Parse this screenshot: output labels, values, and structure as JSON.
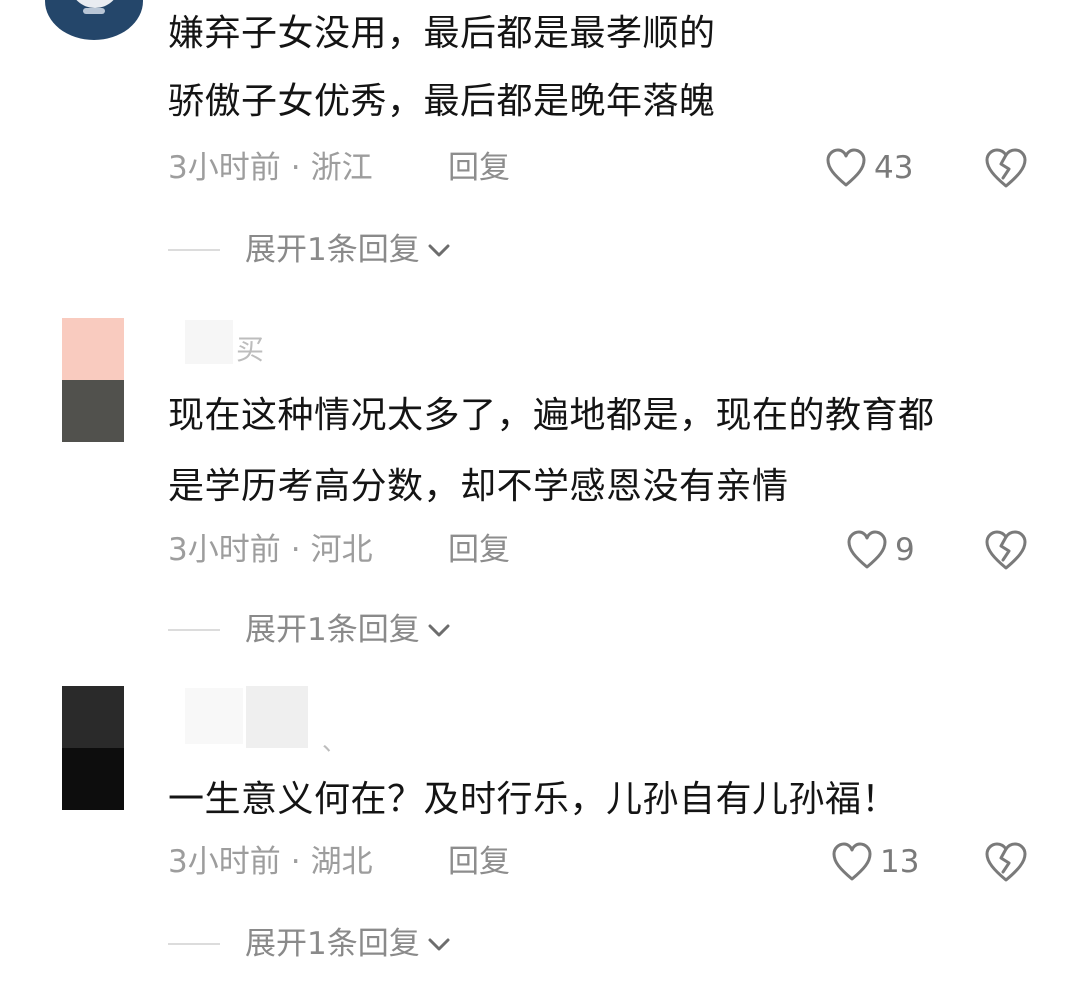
{
  "comments": [
    {
      "lines": [
        "嫌弃子女没用，最后都是最孝顺的",
        "骄傲子女优秀，最后都是晚年落魄"
      ],
      "time": "3小时前",
      "location": "浙江",
      "reply_label": "回复",
      "likes": "43",
      "expand_label": "展开1条回复"
    },
    {
      "username": "买",
      "lines": [
        "现在这种情况太多了，遍地都是，现在的教育都",
        "是学历考高分数，却不学感恩没有亲情"
      ],
      "time": "3小时前",
      "location": "河北",
      "reply_label": "回复",
      "likes": "9",
      "expand_label": "展开1条回复"
    },
    {
      "username": "、",
      "lines": [
        "一生意义何在？及时行乐，儿孙自有儿孙福！"
      ],
      "time": "3小时前",
      "location": "湖北",
      "reply_label": "回复",
      "likes": "13",
      "expand_label": "展开1条回复"
    }
  ],
  "meta_separator": "·",
  "icons": {
    "like": "heart-outline-icon",
    "dislike": "broken-heart-icon",
    "expand": "chevron-down-icon"
  },
  "colors": {
    "text": "#141414",
    "meta": "#9d9d9d",
    "icon": "#7a7a7a"
  }
}
